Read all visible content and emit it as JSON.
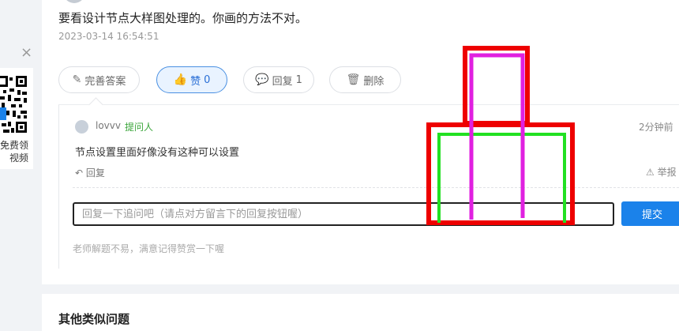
{
  "answer": {
    "text": "要看设计节点大样图处理的。你画的方法不对。",
    "time": "2023-03-14 16:54:51"
  },
  "actions": {
    "complete_answer": "完善答案",
    "like_label": "赞",
    "like_count": "0",
    "reply_label": "回复",
    "reply_count": "1",
    "delete_label": "删除"
  },
  "comment": {
    "user": "lovvv",
    "role_tag": "提问人",
    "time_ago": "2分钟前",
    "text": "节点设置里面好像没有这种可以设置",
    "reply_link": "回复",
    "report_link": "举报"
  },
  "reply_form": {
    "placeholder": "回复一下追问吧（请点对方留言下的回复按钮喔）",
    "submit_label": "提交",
    "hint": "老师解题不易，满意记得赞赏一下喔"
  },
  "left_panel": {
    "close": "×",
    "promo_text": "免费领\n视频"
  },
  "similar": {
    "title": "其他类似问题"
  },
  "colors": {
    "primary": "#1b82ea",
    "sketch_red": "#ee0000",
    "sketch_green": "#22e022",
    "sketch_magenta": "#e020e0"
  }
}
